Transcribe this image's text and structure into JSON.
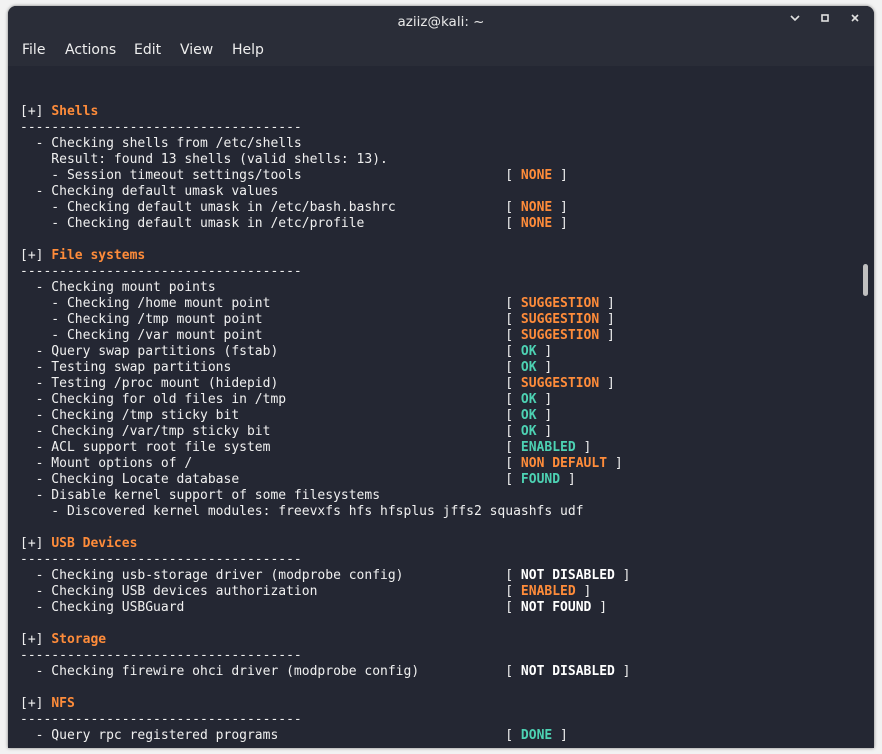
{
  "window": {
    "title": "aziiz@kali: ~"
  },
  "menu": {
    "file": "File",
    "actions": "Actions",
    "edit": "Edit",
    "view": "View",
    "help": "Help"
  },
  "icons": {
    "minimize": "chevron-down-icon",
    "maximize": "square-icon",
    "close": "close-icon"
  },
  "colors": {
    "section": "#ff8c3a",
    "warning": "#ff8c3a",
    "ok": "#4dd2b3",
    "white": "#ffffff",
    "text": "#f0f0f0",
    "background": "#242733"
  },
  "terminal": {
    "lines": [
      {
        "text": ""
      },
      {
        "prefix": "[+] ",
        "section": "Shells"
      },
      {
        "text": "------------------------------------"
      },
      {
        "text": "  - Checking shells from /etc/shells"
      },
      {
        "text": "    Result: found 13 shells (valid shells: 13)."
      },
      {
        "text": "    - Session timeout settings/tools",
        "status": "NONE",
        "color": "warning"
      },
      {
        "text": "  - Checking default umask values"
      },
      {
        "text": "    - Checking default umask in /etc/bash.bashrc",
        "status": "NONE",
        "color": "warning"
      },
      {
        "text": "    - Checking default umask in /etc/profile",
        "status": "NONE",
        "color": "warning"
      },
      {
        "text": ""
      },
      {
        "prefix": "[+] ",
        "section": "File systems"
      },
      {
        "text": "------------------------------------"
      },
      {
        "text": "  - Checking mount points"
      },
      {
        "text": "    - Checking /home mount point",
        "status": "SUGGESTION",
        "color": "warning"
      },
      {
        "text": "    - Checking /tmp mount point",
        "status": "SUGGESTION",
        "color": "warning"
      },
      {
        "text": "    - Checking /var mount point",
        "status": "SUGGESTION",
        "color": "warning"
      },
      {
        "text": "  - Query swap partitions (fstab)",
        "status": "OK",
        "color": "ok"
      },
      {
        "text": "  - Testing swap partitions",
        "status": "OK",
        "color": "ok"
      },
      {
        "text": "  - Testing /proc mount (hidepid)",
        "status": "SUGGESTION",
        "color": "warning"
      },
      {
        "text": "  - Checking for old files in /tmp",
        "status": "OK",
        "color": "ok"
      },
      {
        "text": "  - Checking /tmp sticky bit",
        "status": "OK",
        "color": "ok"
      },
      {
        "text": "  - Checking /var/tmp sticky bit",
        "status": "OK",
        "color": "ok"
      },
      {
        "text": "  - ACL support root file system",
        "status": "ENABLED",
        "color": "ok"
      },
      {
        "text": "  - Mount options of /",
        "status": "NON DEFAULT",
        "color": "warning"
      },
      {
        "text": "  - Checking Locate database",
        "status": "FOUND",
        "color": "ok"
      },
      {
        "text": "  - Disable kernel support of some filesystems"
      },
      {
        "text": "    - Discovered kernel modules: freevxfs hfs hfsplus jffs2 squashfs udf"
      },
      {
        "text": ""
      },
      {
        "prefix": "[+] ",
        "section": "USB Devices"
      },
      {
        "text": "------------------------------------"
      },
      {
        "text": "  - Checking usb-storage driver (modprobe config)",
        "status": "NOT DISABLED",
        "color": "white"
      },
      {
        "text": "  - Checking USB devices authorization",
        "status": "ENABLED",
        "color": "warning"
      },
      {
        "text": "  - Checking USBGuard",
        "status": "NOT FOUND",
        "color": "white"
      },
      {
        "text": ""
      },
      {
        "prefix": "[+] ",
        "section": "Storage"
      },
      {
        "text": "------------------------------------"
      },
      {
        "text": "  - Checking firewire ohci driver (modprobe config)",
        "status": "NOT DISABLED",
        "color": "white"
      },
      {
        "text": ""
      },
      {
        "prefix": "[+] ",
        "section": "NFS"
      },
      {
        "text": "------------------------------------"
      },
      {
        "text": "  - Query rpc registered programs",
        "status": "DONE",
        "color": "ok"
      }
    ]
  }
}
